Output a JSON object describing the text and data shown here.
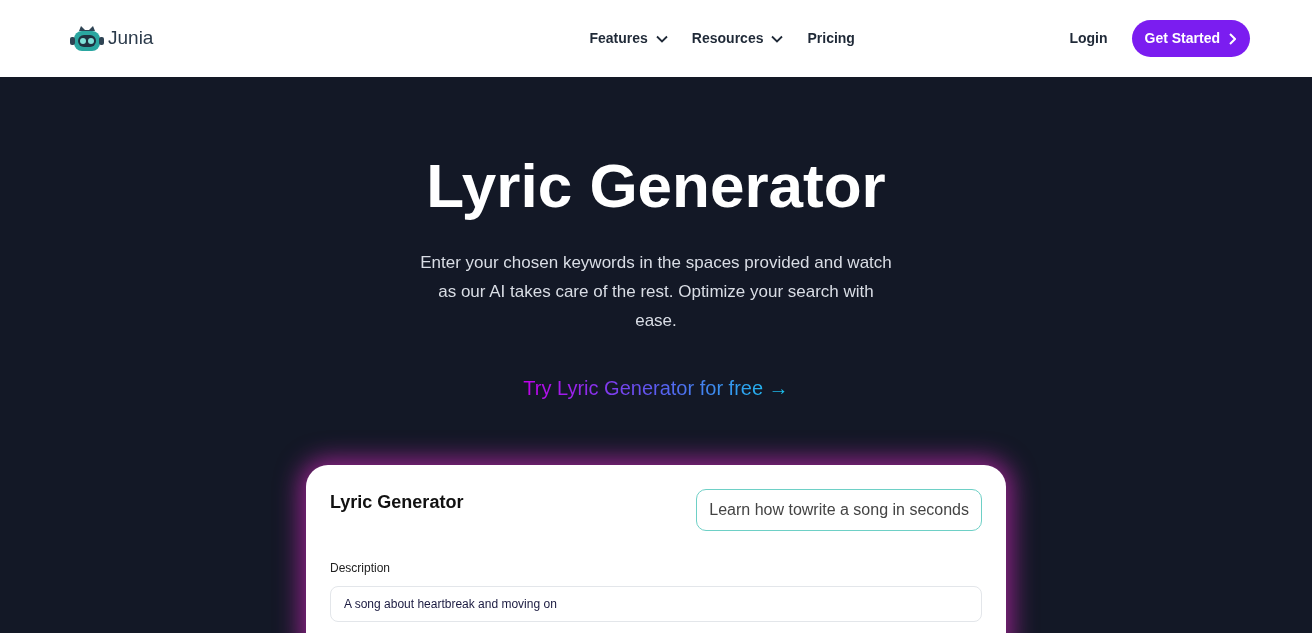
{
  "navbar": {
    "brand": "Junia",
    "menu": [
      {
        "label": "Features",
        "dropdown": true
      },
      {
        "label": "Resources",
        "dropdown": true
      },
      {
        "label": "Pricing",
        "dropdown": false
      }
    ],
    "login": "Login",
    "cta": "Get Started"
  },
  "hero": {
    "title": "Lyric Generator",
    "subtitle": "Enter your chosen keywords in the spaces provided and watch as our AI takes care of the rest. Optimize your search with ease.",
    "try_link": "Try Lyric Generator for free →"
  },
  "tool_card": {
    "title": "Lyric Generator",
    "help_link": "Learn how towrite a song in seconds",
    "fields": [
      {
        "label": "Description",
        "value": "A song about heartbreak and moving on"
      }
    ]
  }
}
